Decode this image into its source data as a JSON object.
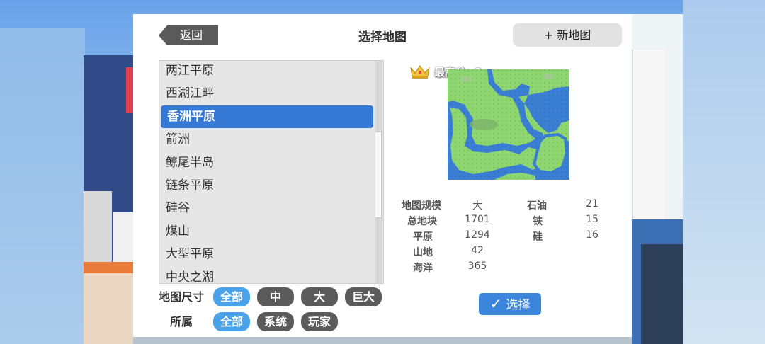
{
  "header": {
    "back_label": "返回",
    "title": "选择地图",
    "new_map_label": "+ 新地图"
  },
  "map_list": {
    "items": [
      "两江平原",
      "西湖江畔",
      "香洲平原",
      "箭洲",
      "鲸尾半岛",
      "链条平原",
      "硅谷",
      "煤山",
      "大型平原",
      "中央之湖"
    ],
    "selected_index": 2
  },
  "filters": {
    "size_label": "地图尺寸",
    "size_options": [
      "全部",
      "中",
      "大",
      "巨大"
    ],
    "size_active": 0,
    "owner_label": "所属",
    "owner_options": [
      "全部",
      "系统",
      "玩家"
    ],
    "owner_active": 0
  },
  "preview": {
    "high_score": "最高分: 0",
    "icon": "crown-icon",
    "land_color": "#8ed66f",
    "water_color": "#3a7fd4"
  },
  "stats": {
    "left": [
      {
        "label": "地图规模",
        "value": "大"
      },
      {
        "label": "总地块",
        "value": "1701"
      },
      {
        "label": "平原",
        "value": "1294"
      },
      {
        "label": "山地",
        "value": "42"
      },
      {
        "label": "海洋",
        "value": "365"
      }
    ],
    "right": [
      {
        "label": "石油",
        "value": "21"
      },
      {
        "label": "铁",
        "value": "15"
      },
      {
        "label": "硅",
        "value": "16"
      }
    ]
  },
  "select_label": "选择",
  "colors": {
    "accent": "#3579d4",
    "chip_active": "#4aa3e8",
    "chip_inactive": "#5b5b5b"
  }
}
